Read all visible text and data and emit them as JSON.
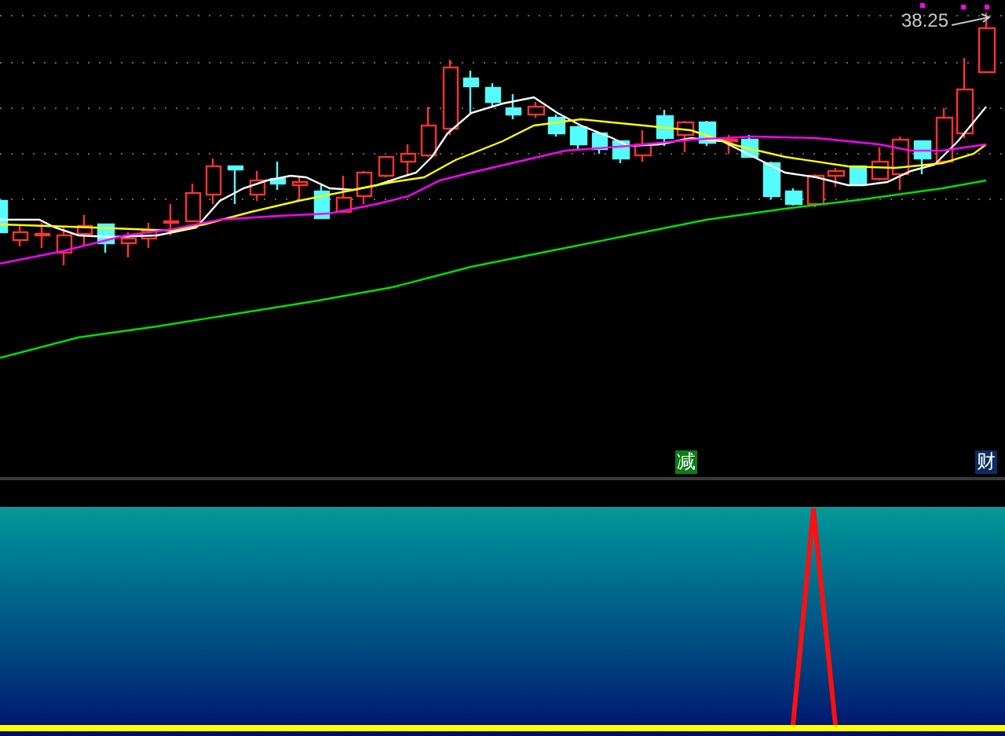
{
  "price_label": "38.25",
  "markers": [
    {
      "text": "减",
      "color": "#0b7d16"
    },
    {
      "text": "财",
      "color": "#0b2d5e"
    }
  ]
}
